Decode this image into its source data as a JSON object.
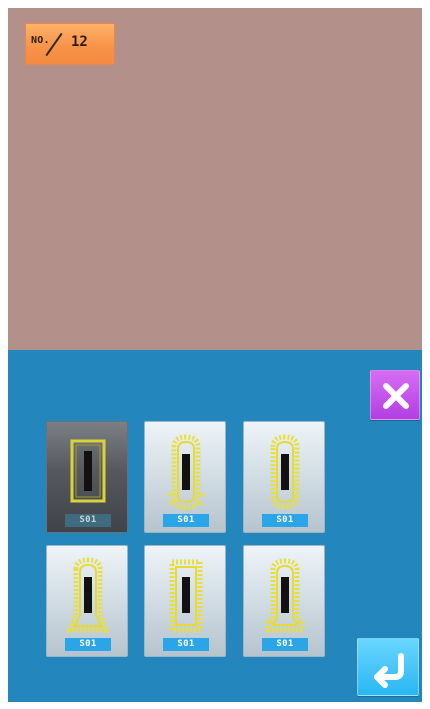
{
  "header": {
    "no_label": "NO.",
    "no_value": "12"
  },
  "colors": {
    "preview_bg": "#b3918a",
    "panel_bg": "#2387bd",
    "badge_orange": "#f7944a",
    "close_purple": "#c65be9",
    "enter_blue": "#2ab7f2",
    "shape_yellow": "#e9e13a"
  },
  "shapes": [
    {
      "code": "S01",
      "selected": true
    },
    {
      "code": "S01",
      "selected": false
    },
    {
      "code": "S01",
      "selected": false
    },
    {
      "code": "S01",
      "selected": false
    },
    {
      "code": "S01",
      "selected": false
    },
    {
      "code": "S01",
      "selected": false
    }
  ],
  "icons": {
    "close": "close-icon",
    "enter": "enter-icon"
  }
}
